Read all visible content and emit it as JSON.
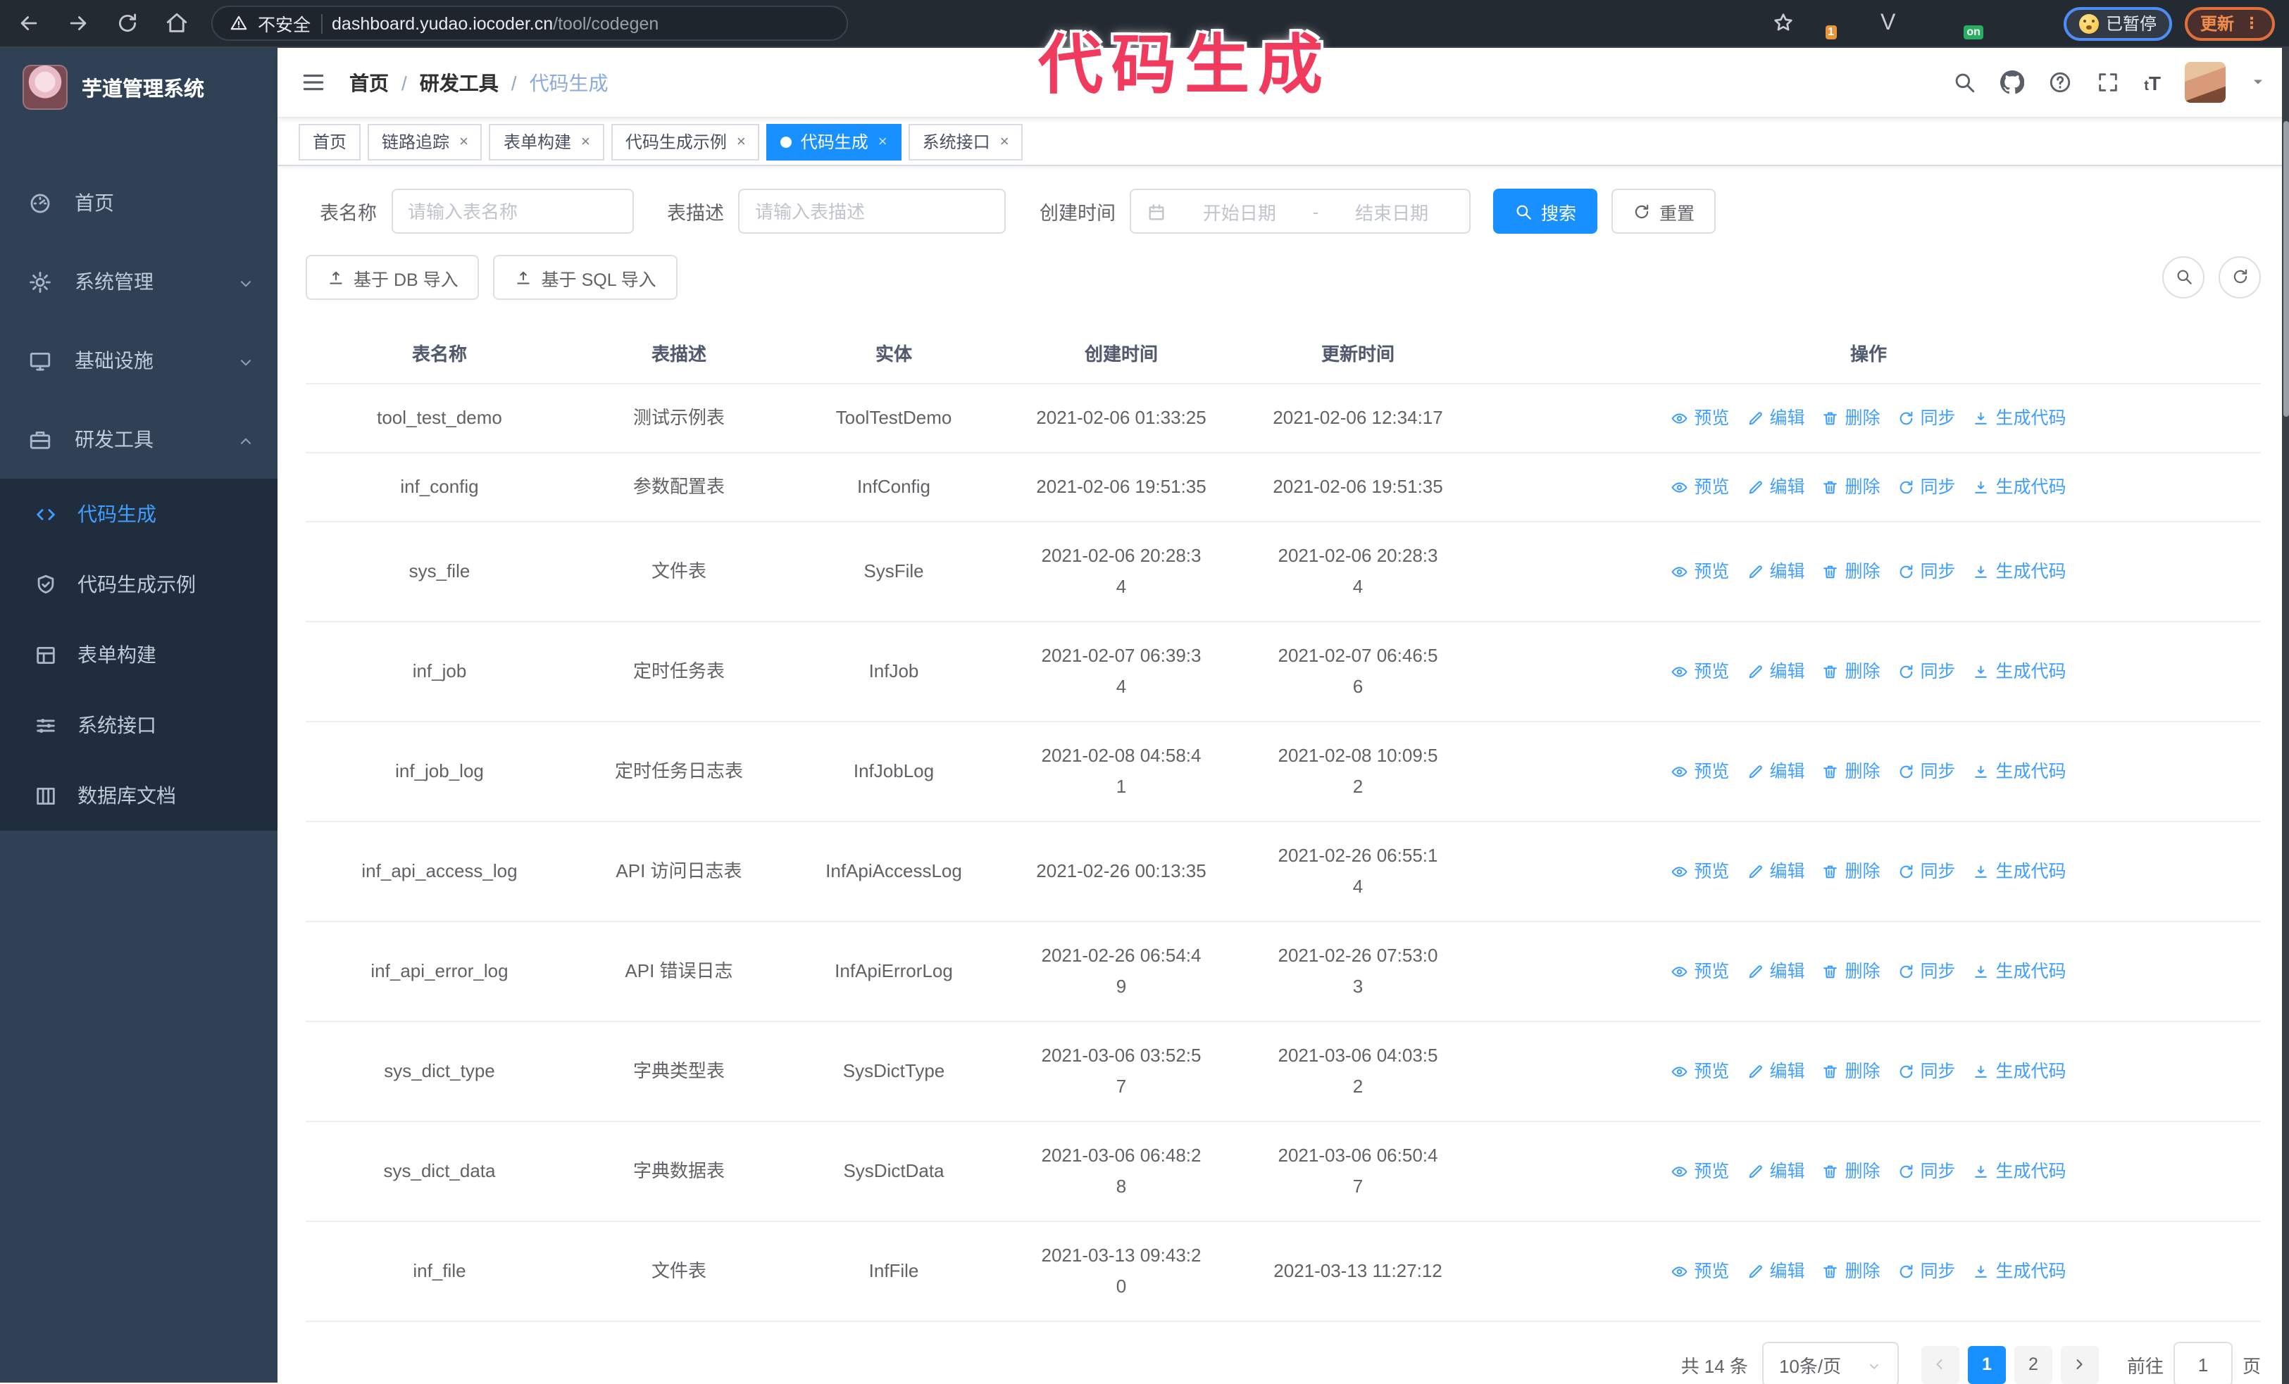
{
  "overlay": {
    "annotation": "代码生成"
  },
  "browser": {
    "security_warning": "不安全",
    "url_host": "dashboard.yudao.iocoder.cn",
    "url_path": "/tool/codegen",
    "paused_label": "已暂停",
    "update_label": "更新",
    "extensions": [
      {
        "name": "extension-ring-icon",
        "badge": "1"
      },
      {
        "name": "extension-gem-icon"
      },
      {
        "name": "extension-check-icon"
      },
      {
        "name": "extension-columns-icon"
      },
      {
        "name": "extension-on-icon",
        "badge": "on"
      },
      {
        "name": "extension-android-icon"
      },
      {
        "name": "extension-puzzle-icon"
      }
    ]
  },
  "sidebar": {
    "app_title": "芋道管理系统",
    "items": [
      {
        "icon": "dashboard-icon",
        "label": "首页"
      },
      {
        "icon": "gear-icon",
        "label": "系统管理",
        "chevron": "down"
      },
      {
        "icon": "monitor-icon",
        "label": "基础设施",
        "chevron": "down"
      },
      {
        "icon": "toolbox-icon",
        "label": "研发工具",
        "chevron": "up",
        "expanded": true
      }
    ],
    "subitems": [
      {
        "icon": "code-icon",
        "label": "代码生成",
        "active": true
      },
      {
        "icon": "shield-check-icon",
        "label": "代码生成示例"
      },
      {
        "icon": "form-icon",
        "label": "表单构建"
      },
      {
        "icon": "sliders-icon",
        "label": "系统接口"
      },
      {
        "icon": "table-columns-icon",
        "label": "数据库文档"
      }
    ]
  },
  "navbar": {
    "breadcrumb": [
      "首页",
      "研发工具",
      "代码生成"
    ],
    "font_size_icon_text_small": "t",
    "font_size_icon_text_big": "T"
  },
  "tabs": [
    {
      "label": "首页",
      "closable": false
    },
    {
      "label": "链路追踪",
      "closable": true
    },
    {
      "label": "表单构建",
      "closable": true
    },
    {
      "label": "代码生成示例",
      "closable": true
    },
    {
      "label": "代码生成",
      "closable": true,
      "active": true
    },
    {
      "label": "系统接口",
      "closable": true
    }
  ],
  "filters": {
    "name_label": "表名称",
    "name_placeholder": "请输入表名称",
    "desc_label": "表描述",
    "desc_placeholder": "请输入表描述",
    "date_label": "创建时间",
    "date_start_placeholder": "开始日期",
    "date_separator": "-",
    "date_end_placeholder": "结束日期",
    "search_label": "搜索",
    "reset_label": "重置"
  },
  "toolbar": {
    "db_import_label": "基于 DB 导入",
    "sql_import_label": "基于 SQL 导入"
  },
  "table": {
    "columns": [
      "表名称",
      "表描述",
      "实体",
      "创建时间",
      "更新时间",
      "操作"
    ],
    "actions": [
      {
        "label": "预览",
        "icon": "eye-icon",
        "name": "preview-link"
      },
      {
        "label": "编辑",
        "icon": "edit-icon",
        "name": "edit-link"
      },
      {
        "label": "删除",
        "icon": "delete-icon",
        "name": "delete-link"
      },
      {
        "label": "同步",
        "icon": "sync-icon",
        "name": "sync-link"
      },
      {
        "label": "生成代码",
        "icon": "download-icon",
        "name": "generate-code-link"
      }
    ],
    "rows": [
      {
        "name": "tool_test_demo",
        "desc": "测试示例表",
        "entity": "ToolTestDemo",
        "created": "2021-02-06 01:33:25",
        "updated": "2021-02-06 12:34:17"
      },
      {
        "name": "inf_config",
        "desc": "参数配置表",
        "entity": "InfConfig",
        "created": "2021-02-06 19:51:35",
        "updated": "2021-02-06 19:51:35"
      },
      {
        "name": "sys_file",
        "desc": "文件表",
        "entity": "SysFile",
        "created": "2021-02-06 20:28:3\n4",
        "updated": "2021-02-06 20:28:3\n4"
      },
      {
        "name": "inf_job",
        "desc": "定时任务表",
        "entity": "InfJob",
        "created": "2021-02-07 06:39:3\n4",
        "updated": "2021-02-07 06:46:5\n6"
      },
      {
        "name": "inf_job_log",
        "desc": "定时任务日志表",
        "entity": "InfJobLog",
        "created": "2021-02-08 04:58:4\n1",
        "updated": "2021-02-08 10:09:5\n2"
      },
      {
        "name": "inf_api_access_log",
        "desc": "API 访问日志表",
        "entity": "InfApiAccessLog",
        "created": "2021-02-26 00:13:35",
        "updated": "2021-02-26 06:55:1\n4"
      },
      {
        "name": "inf_api_error_log",
        "desc": "API 错误日志",
        "entity": "InfApiErrorLog",
        "created": "2021-02-26 06:54:4\n9",
        "updated": "2021-02-26 07:53:0\n3"
      },
      {
        "name": "sys_dict_type",
        "desc": "字典类型表",
        "entity": "SysDictType",
        "created": "2021-03-06 03:52:5\n7",
        "updated": "2021-03-06 04:03:5\n2"
      },
      {
        "name": "sys_dict_data",
        "desc": "字典数据表",
        "entity": "SysDictData",
        "created": "2021-03-06 06:48:2\n8",
        "updated": "2021-03-06 06:50:4\n7"
      },
      {
        "name": "inf_file",
        "desc": "文件表",
        "entity": "InfFile",
        "created": "2021-03-13 09:43:2\n0",
        "updated": "2021-03-13 11:27:12"
      }
    ]
  },
  "pagination": {
    "total": "共 14 条",
    "page_size": "10条/页",
    "pages": [
      "1",
      "2"
    ],
    "active_page": "1",
    "goto_label": "前往",
    "goto_value": "1",
    "page_suffix": "页"
  },
  "colors": {
    "accent": "#1890ff",
    "link": "#409eff",
    "sidebar_bg": "#304156",
    "submenu_bg": "#1f2d3d",
    "annotation": "#f13b5e"
  }
}
